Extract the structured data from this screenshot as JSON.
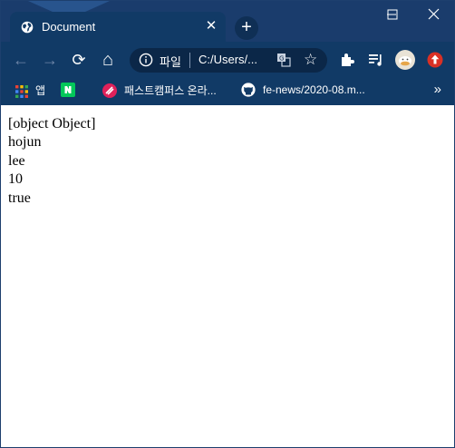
{
  "tab": {
    "title": "Document",
    "close_glyph": "✕"
  },
  "newtab_glyph": "+",
  "window_controls": {
    "minimize": "—",
    "maximize": "☐",
    "close": "✕"
  },
  "toolbar": {
    "back": "←",
    "forward": "→",
    "reload": "⟳",
    "home": "⌂"
  },
  "omnibox": {
    "scheme_label": "파일",
    "url": "C:/Users/...",
    "star": "☆"
  },
  "bookmarks": [
    {
      "label": "앱",
      "icon": "apps-grid-icon"
    },
    {
      "label": "",
      "icon": "naver-icon"
    },
    {
      "label": "패스트캠퍼스 온라...",
      "icon": "fastcampus-icon"
    },
    {
      "label": "fe-news/2020-08.m...",
      "icon": "github-icon"
    }
  ],
  "bookmarks_more": "»",
  "page_output": [
    "[object Object]",
    "hojun",
    "lee",
    "10",
    "true"
  ],
  "colors": {
    "frame": "#1a3c6c",
    "toolbar": "#113a66",
    "omnibox": "#0b2748"
  }
}
